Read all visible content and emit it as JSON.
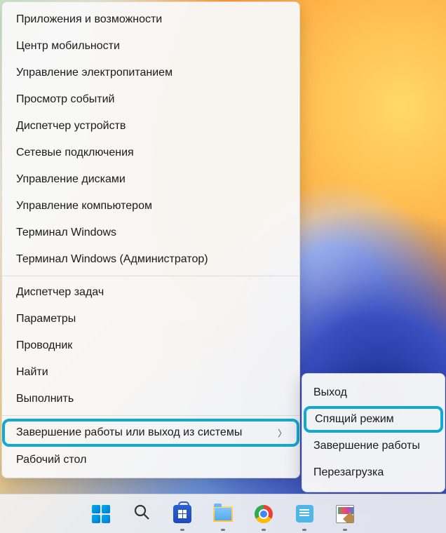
{
  "menu": {
    "groups": [
      [
        {
          "id": "apps",
          "label": "Приложения и возможности"
        },
        {
          "id": "mobility",
          "label": "Центр мобильности"
        },
        {
          "id": "power",
          "label": "Управление электропитанием"
        },
        {
          "id": "events",
          "label": "Просмотр событий"
        },
        {
          "id": "devices",
          "label": "Диспетчер устройств"
        },
        {
          "id": "network",
          "label": "Сетевые подключения"
        },
        {
          "id": "disks",
          "label": "Управление дисками"
        },
        {
          "id": "computer",
          "label": "Управление компьютером"
        },
        {
          "id": "terminal",
          "label": "Терминал Windows"
        },
        {
          "id": "terminal-admin",
          "label": "Терминал Windows (Администратор)"
        }
      ],
      [
        {
          "id": "taskmgr",
          "label": "Диспетчер задач"
        },
        {
          "id": "settings",
          "label": "Параметры"
        },
        {
          "id": "explorer",
          "label": "Проводник"
        },
        {
          "id": "search",
          "label": "Найти"
        },
        {
          "id": "run",
          "label": "Выполнить"
        }
      ],
      [
        {
          "id": "shutdown-signout",
          "label": "Завершение работы или выход из системы",
          "hasSubmenu": true,
          "highlighted": true
        },
        {
          "id": "desktop",
          "label": "Рабочий стол"
        }
      ]
    ]
  },
  "submenu": {
    "items": [
      {
        "id": "signout",
        "label": "Выход"
      },
      {
        "id": "sleep",
        "label": "Спящий режим",
        "highlighted": true
      },
      {
        "id": "shutdown",
        "label": "Завершение работы"
      },
      {
        "id": "restart",
        "label": "Перезагрузка"
      }
    ]
  },
  "taskbar": {
    "items": [
      {
        "id": "start",
        "name": "start-button"
      },
      {
        "id": "search",
        "name": "search-button"
      },
      {
        "id": "store",
        "name": "store-button",
        "running": true
      },
      {
        "id": "explorer",
        "name": "explorer-button",
        "running": true
      },
      {
        "id": "chrome",
        "name": "chrome-button",
        "running": true
      },
      {
        "id": "notes",
        "name": "notes-button",
        "running": true
      },
      {
        "id": "paint",
        "name": "paint-button",
        "running": true
      }
    ]
  }
}
